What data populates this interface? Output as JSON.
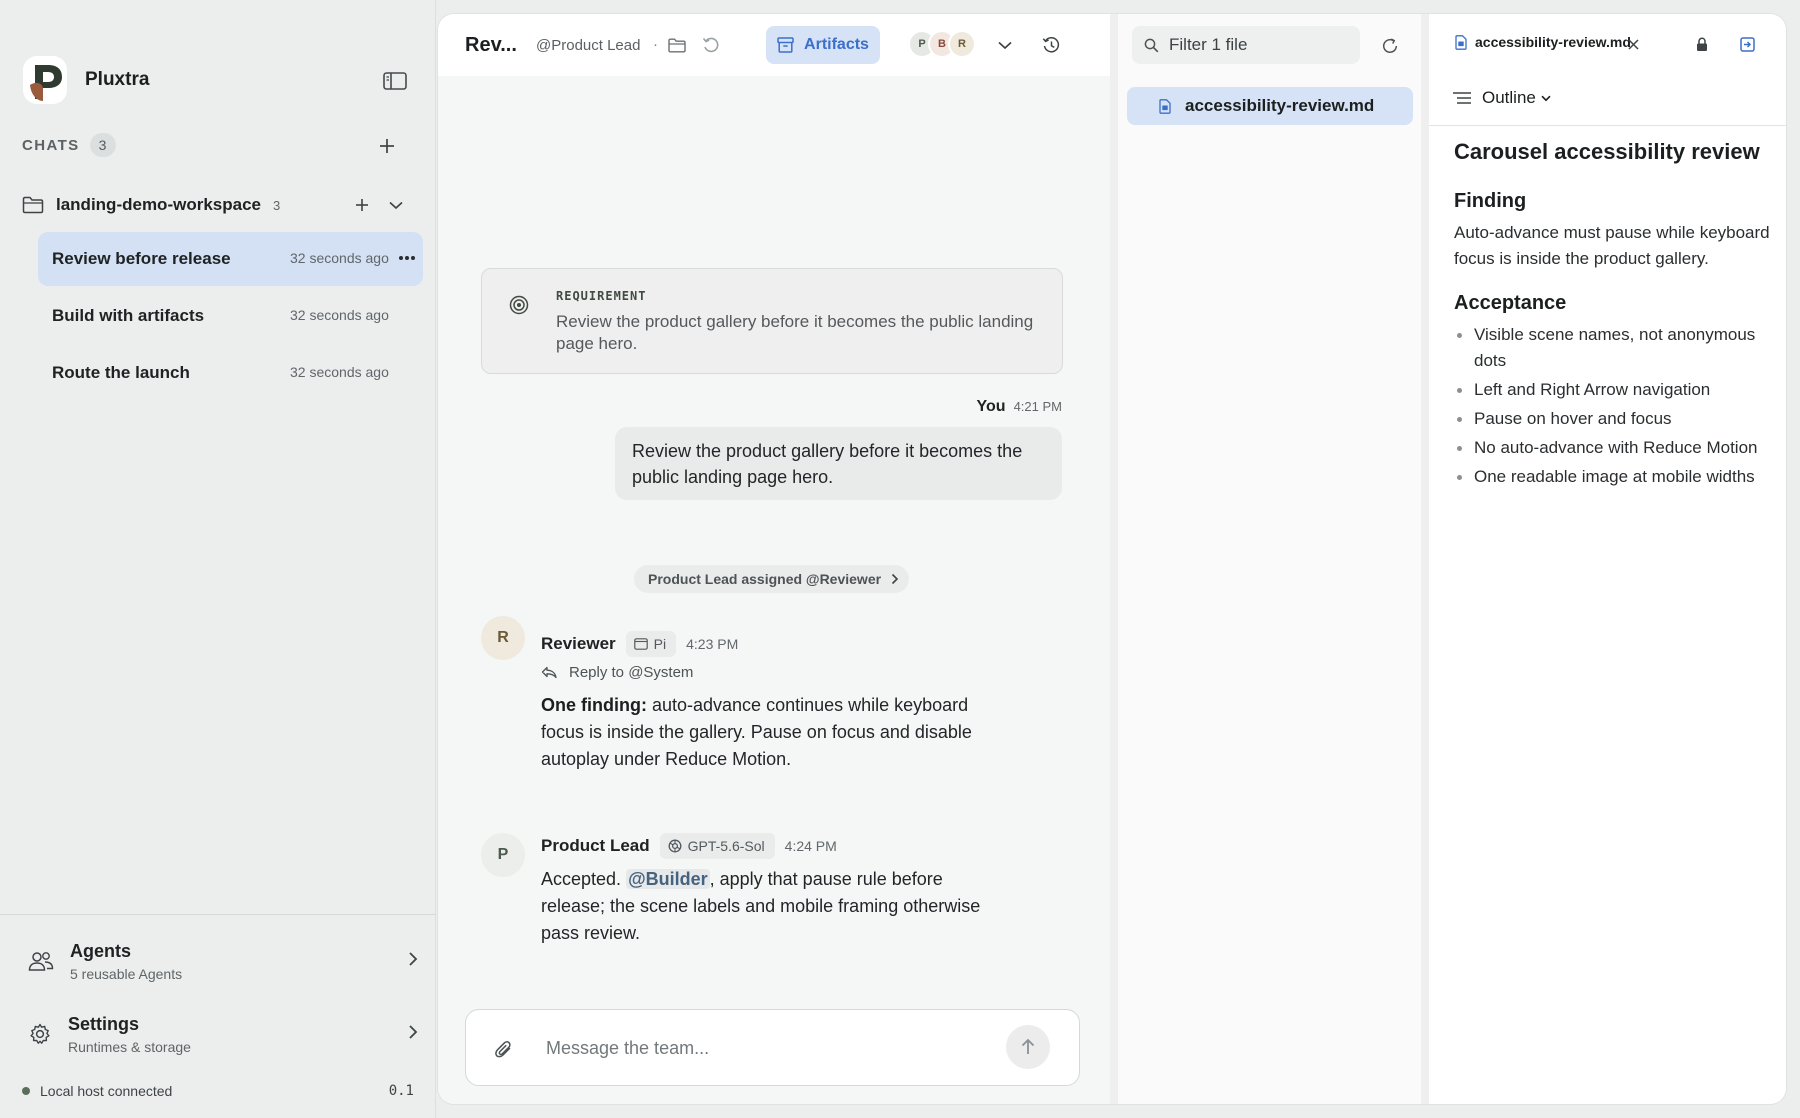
{
  "sidebar": {
    "brand_name": "Pluxtra",
    "chats_label": "CHATS",
    "chats_count": "3",
    "workspace": {
      "name": "landing-demo-workspace",
      "count": "3"
    },
    "chats": [
      {
        "title": "Review before release",
        "time": "32 seconds ago",
        "active": true
      },
      {
        "title": "Build with artifacts",
        "time": "32 seconds ago",
        "active": false
      },
      {
        "title": "Route the launch",
        "time": "32 seconds ago",
        "active": false
      }
    ],
    "agents": {
      "title": "Agents",
      "subtitle": "5 reusable Agents"
    },
    "settings": {
      "title": "Settings",
      "subtitle": "Runtimes & storage"
    },
    "status": {
      "text": "Local host connected",
      "version": "0.1"
    }
  },
  "chat": {
    "heading": "Rev...",
    "mention": "@Product Lead",
    "separator": "·",
    "artifacts_label": "Artifacts",
    "participants": [
      {
        "initial": "P",
        "bg": "#e6e9e3",
        "fg": "#4c5b4d"
      },
      {
        "initial": "B",
        "bg": "#f3e7e2",
        "fg": "#8a4a3b"
      },
      {
        "initial": "R",
        "bg": "#efeadd",
        "fg": "#6a5a35"
      }
    ],
    "requirement": {
      "label": "REQUIREMENT",
      "text": "Review the product gallery before it becomes the public landing page hero."
    },
    "user_message": {
      "sender": "You",
      "time": "4:21 PM",
      "text": "Review the product gallery before it becomes the public landing page hero."
    },
    "assignment": "Product Lead assigned @Reviewer",
    "messages": [
      {
        "avatar": "R",
        "name": "Reviewer",
        "model": "Pi",
        "time": "4:23 PM",
        "reply_to": "Reply to @System",
        "bold": "One finding:",
        "text": " auto-advance continues while keyboard focus is inside the gallery. Pause on focus and disable autoplay under Reduce Motion."
      },
      {
        "avatar": "P",
        "name": "Product Lead",
        "model": "GPT-5.6-Sol",
        "time": "4:24 PM",
        "lead": "Accepted. ",
        "mention": "@Builder",
        "text": ", apply that pause rule before release; the scene labels and mobile framing otherwise pass review."
      }
    ],
    "composer_placeholder": "Message the team..."
  },
  "files": {
    "filter_placeholder": "Filter 1 file",
    "items": [
      {
        "name": "accessibility-review.md"
      }
    ]
  },
  "document": {
    "tab_name": "accessibility-review.md",
    "outline_label": "Outline",
    "title": "Carousel accessibility review",
    "finding_heading": "Finding",
    "finding_text": "Auto-advance must pause while keyboard focus is inside the product gallery.",
    "acceptance_heading": "Acceptance",
    "acceptance_items": [
      "Visible scene names, not anonymous dots",
      "Left and Right Arrow navigation",
      "Pause on hover and focus",
      "No auto-advance with Reduce Motion",
      "One readable image at mobile widths"
    ]
  },
  "colors": {
    "accent": "#3c6fc9",
    "accent_bg": "#d6e3f6",
    "brand_dark": "#2f3b30",
    "brand_warm": "#9a5b3c",
    "status_dot": "#5a6e5c"
  },
  "icons": {
    "sidebar_toggle": "sidebar-toggle-icon",
    "plus": "plus-icon",
    "folder": "folder-icon",
    "chevron": "chevron-down-icon",
    "more": "ellipsis-icon",
    "agents": "users-icon",
    "settings": "gear-icon",
    "artifacts": "archive-icon",
    "history": "history-icon",
    "undo": "undo-icon",
    "target": "target-icon",
    "reply": "reply-icon",
    "attach": "paperclip-icon",
    "send": "arrow-up-icon",
    "search": "search-icon",
    "refresh": "refresh-icon",
    "file": "file-icon",
    "close": "close-icon",
    "lock": "lock-icon",
    "exit": "exit-panel-icon",
    "outline": "list-icon"
  }
}
